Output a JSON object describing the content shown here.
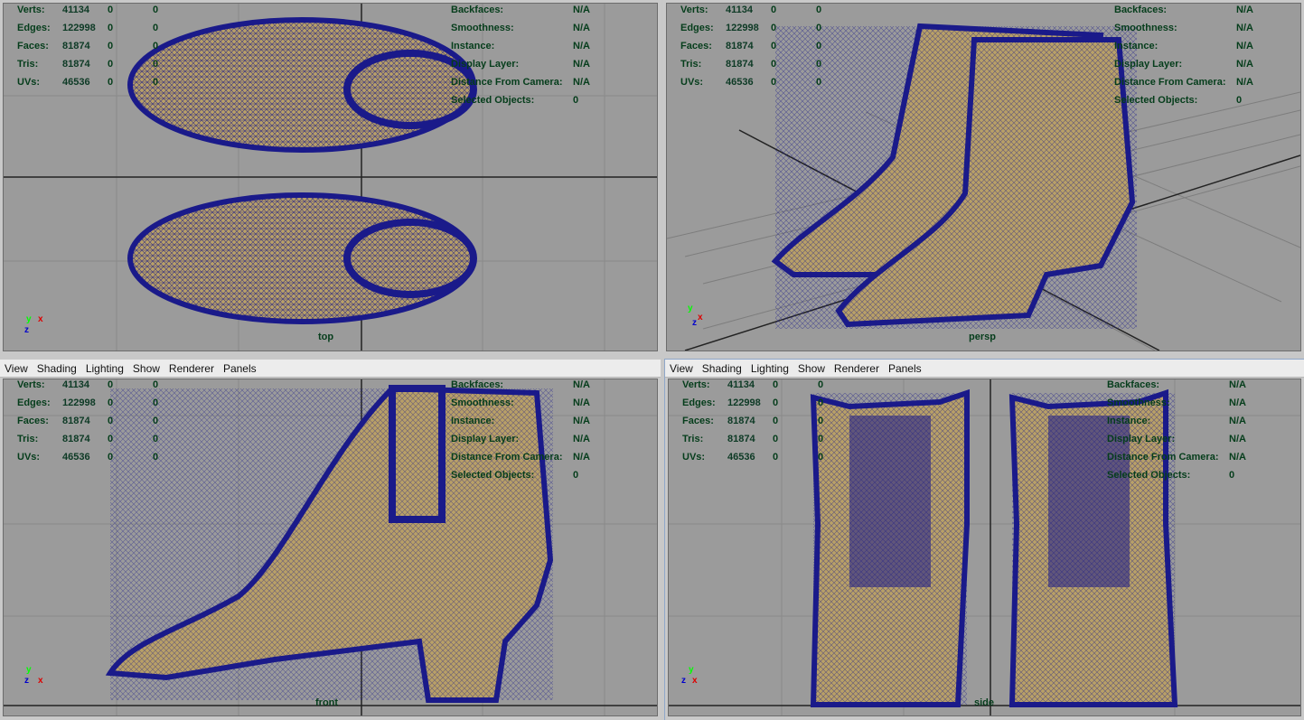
{
  "menu": [
    "View",
    "Shading",
    "Lighting",
    "Show",
    "Renderer",
    "Panels"
  ],
  "hud_stats": [
    {
      "label": "Verts:",
      "v1": "41134",
      "v2": "0",
      "v3": "0"
    },
    {
      "label": "Edges:",
      "v1": "122998",
      "v2": "0",
      "v3": "0"
    },
    {
      "label": "Faces:",
      "v1": "81874",
      "v2": "0",
      "v3": "0"
    },
    {
      "label": "Tris:",
      "v1": "81874",
      "v2": "0",
      "v3": "0"
    },
    {
      "label": "UVs:",
      "v1": "46536",
      "v2": "0",
      "v3": "0"
    }
  ],
  "hud_info": [
    {
      "label": "Backfaces:",
      "value": "N/A"
    },
    {
      "label": "Smoothness:",
      "value": "N/A"
    },
    {
      "label": "Instance:",
      "value": "N/A"
    },
    {
      "label": "Display Layer:",
      "value": "N/A"
    },
    {
      "label": "Distance From Camera:",
      "value": "N/A"
    },
    {
      "label": "Selected Objects:",
      "value": "0"
    }
  ],
  "panels": [
    {
      "camera": "top",
      "has_menu": false
    },
    {
      "camera": "persp",
      "has_menu": false
    },
    {
      "camera": "front",
      "has_menu": true
    },
    {
      "camera": "side",
      "has_menu": true
    }
  ],
  "axis_labels": {
    "x": "x",
    "y": "y",
    "z": "z"
  },
  "colors": {
    "mesh_wire": "#1a1a8a",
    "mesh_fill": "#b8a067",
    "viewport_bg": "#9b9b9b",
    "hud_text": "#053d1b",
    "grid": "#8a8a8a"
  }
}
